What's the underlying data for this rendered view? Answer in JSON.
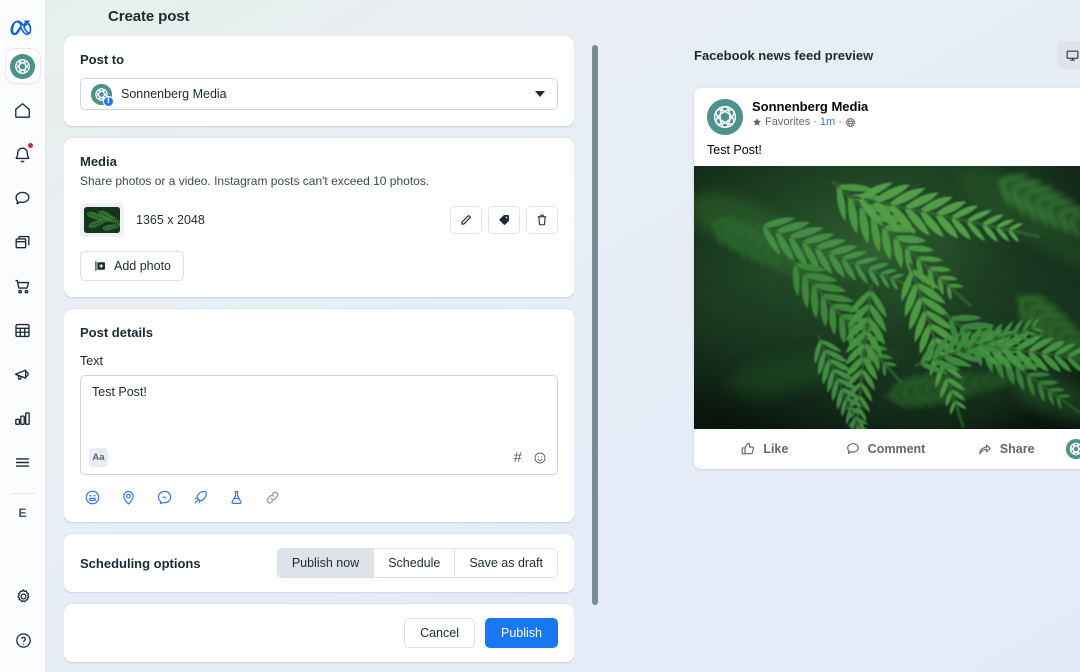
{
  "page": {
    "title": "Create post"
  },
  "sidebar": {
    "logo": "meta-logo",
    "brand_initial": "E",
    "items": [
      {
        "icon": "brand-avatar-icon",
        "name": "workspace"
      },
      {
        "icon": "home-icon",
        "name": "home"
      },
      {
        "icon": "bell-icon",
        "name": "notifications",
        "badge": true
      },
      {
        "icon": "chat-bubble-icon",
        "name": "messages"
      },
      {
        "icon": "content-library-icon",
        "name": "content"
      },
      {
        "icon": "shopping-cart-icon",
        "name": "commerce"
      },
      {
        "icon": "grid-table-icon",
        "name": "planner"
      },
      {
        "icon": "megaphone-icon",
        "name": "ads"
      },
      {
        "icon": "bar-chart-icon",
        "name": "insights"
      },
      {
        "icon": "hamburger-menu-icon",
        "name": "more"
      }
    ],
    "bottom_items": [
      {
        "icon": "gear-icon",
        "name": "settings"
      },
      {
        "icon": "help-circle-icon",
        "name": "help"
      }
    ]
  },
  "post_to": {
    "heading": "Post to",
    "selected": "Sonnenberg Media",
    "caret_icon": "chevron-down-icon",
    "badge_icon": "facebook-badge-icon"
  },
  "media": {
    "heading": "Media",
    "description": "Share photos or a video. Instagram posts can't exceed 10 photos.",
    "file_dimensions": "1365 x 2048",
    "actions": [
      {
        "icon": "pencil-icon",
        "name": "edit-media"
      },
      {
        "icon": "tag-icon",
        "name": "tag-media"
      },
      {
        "icon": "trash-icon",
        "name": "delete-media"
      }
    ],
    "add_photo_label": "Add photo",
    "add_photo_icon": "add-photo-icon"
  },
  "post_details": {
    "heading": "Post details",
    "text_label": "Text",
    "text_value": "Test Post!",
    "format_button": "Aa",
    "hash_icon": "hashtag-icon",
    "emoji_icon": "emoji-smile-icon",
    "tools": [
      {
        "icon": "emoji-face-icon",
        "name": "add-emoji",
        "color": "#3578e5"
      },
      {
        "icon": "location-pin-icon",
        "name": "add-location",
        "color": "#3578e5"
      },
      {
        "icon": "messenger-icon",
        "name": "messenger-cta",
        "color": "#3578e5"
      },
      {
        "icon": "rocket-icon",
        "name": "boost-post",
        "color": "#3578e5"
      },
      {
        "icon": "flask-icon",
        "name": "ab-test",
        "color": "#3578e5"
      },
      {
        "icon": "link-icon",
        "name": "add-link",
        "color": "#8a949c"
      }
    ]
  },
  "scheduling": {
    "heading": "Scheduling options",
    "options": [
      {
        "label": "Publish now",
        "selected": true
      },
      {
        "label": "Schedule",
        "selected": false
      },
      {
        "label": "Save as draft",
        "selected": false
      }
    ]
  },
  "footer": {
    "cancel_label": "Cancel",
    "publish_label": "Publish"
  },
  "preview": {
    "title": "Facebook news feed preview",
    "devices": [
      {
        "icon": "desktop-monitor-icon",
        "name": "desktop",
        "selected": true
      },
      {
        "icon": "mobile-phone-icon",
        "name": "mobile",
        "selected": false
      }
    ],
    "post": {
      "author": "Sonnenberg Media",
      "favorites_label": "Favorites",
      "favorites_icon": "star-icon",
      "timestamp": "1m",
      "audience_icon": "globe-icon",
      "separator": "·",
      "menu_icon": "ellipsis-icon",
      "body": "Test Post!",
      "image_alt": "fern-leaves-photo",
      "actions": [
        {
          "label": "Like",
          "icon": "thumbs-up-icon"
        },
        {
          "label": "Comment",
          "icon": "comment-bubble-icon"
        },
        {
          "label": "Share",
          "icon": "share-arrow-icon"
        }
      ],
      "avatar_dropdown_icon": "chevron-down-icon"
    }
  },
  "colors": {
    "brand_teal": "#4d918d",
    "facebook_blue": "#1877f2",
    "link_blue": "#3578e5",
    "notification_red": "#e41e3f"
  }
}
